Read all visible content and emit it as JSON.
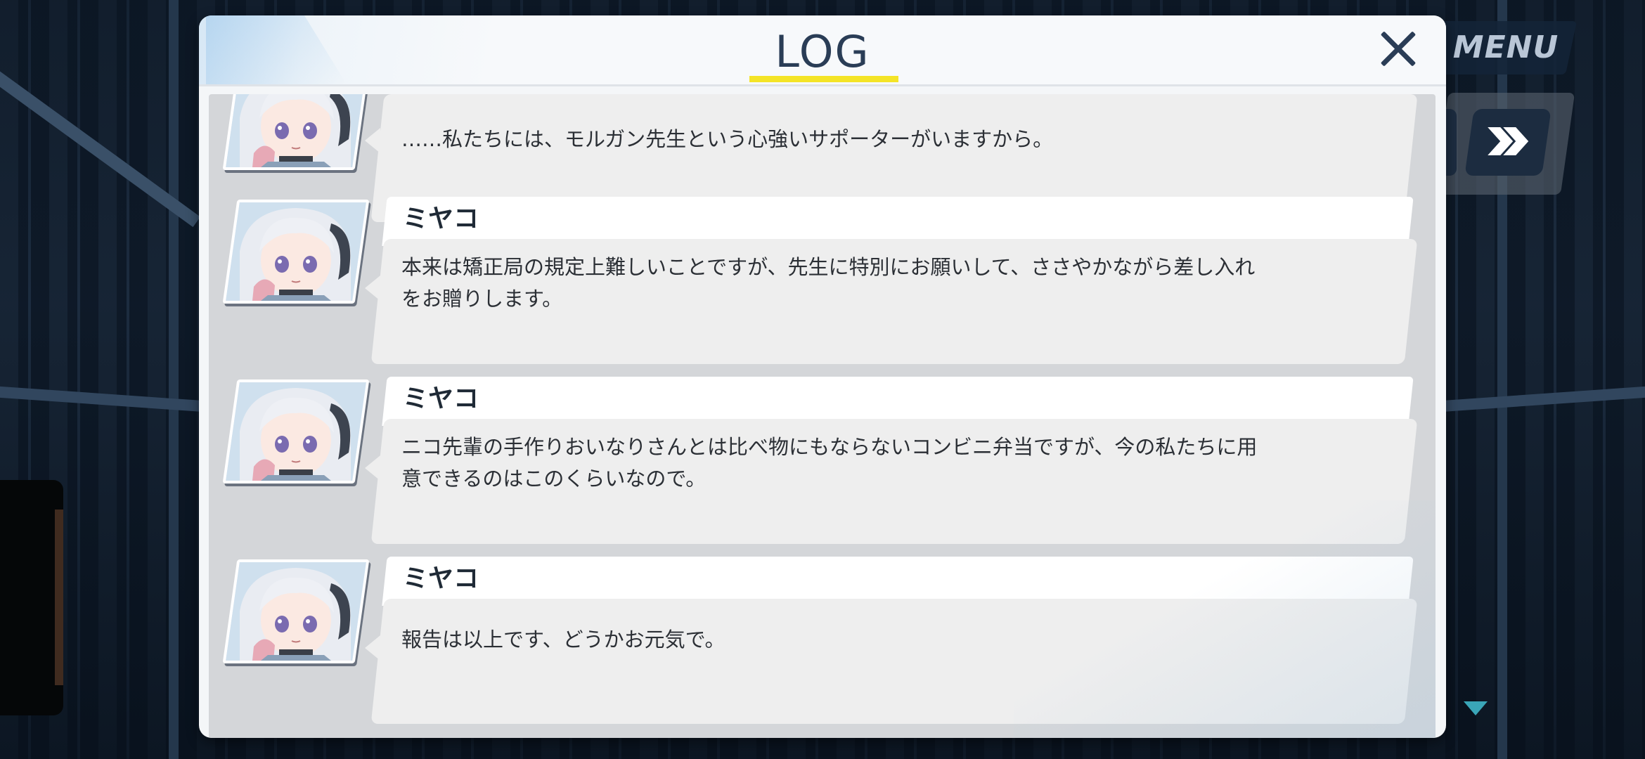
{
  "hud": {
    "menu_label": "MENU"
  },
  "log": {
    "title": "LOG",
    "accent_color": "#f4e427",
    "entries": [
      {
        "speaker": "",
        "text": "……私たちには、モルガン先生という心強いサポーターがいますから。"
      },
      {
        "speaker": "ミヤコ",
        "text": "本来は矯正局の規定上難しいことですが、先生に特別にお願いして、ささやかながら差し入れをお贈りします。"
      },
      {
        "speaker": "ミヤコ",
        "text": "ニコ先輩の手作りおいなりさんとは比べ物にもならないコンビニ弁当ですが、今の私たちに用意できるのはこのくらいなので。"
      },
      {
        "speaker": "ミヤコ",
        "text": "報告は以上です、どうかお元気で。"
      }
    ]
  },
  "icons": {
    "close": "close-icon",
    "fast_forward": "fast-forward-icon",
    "scroll_down": "scroll-down-icon",
    "avatar": "character-portrait"
  }
}
